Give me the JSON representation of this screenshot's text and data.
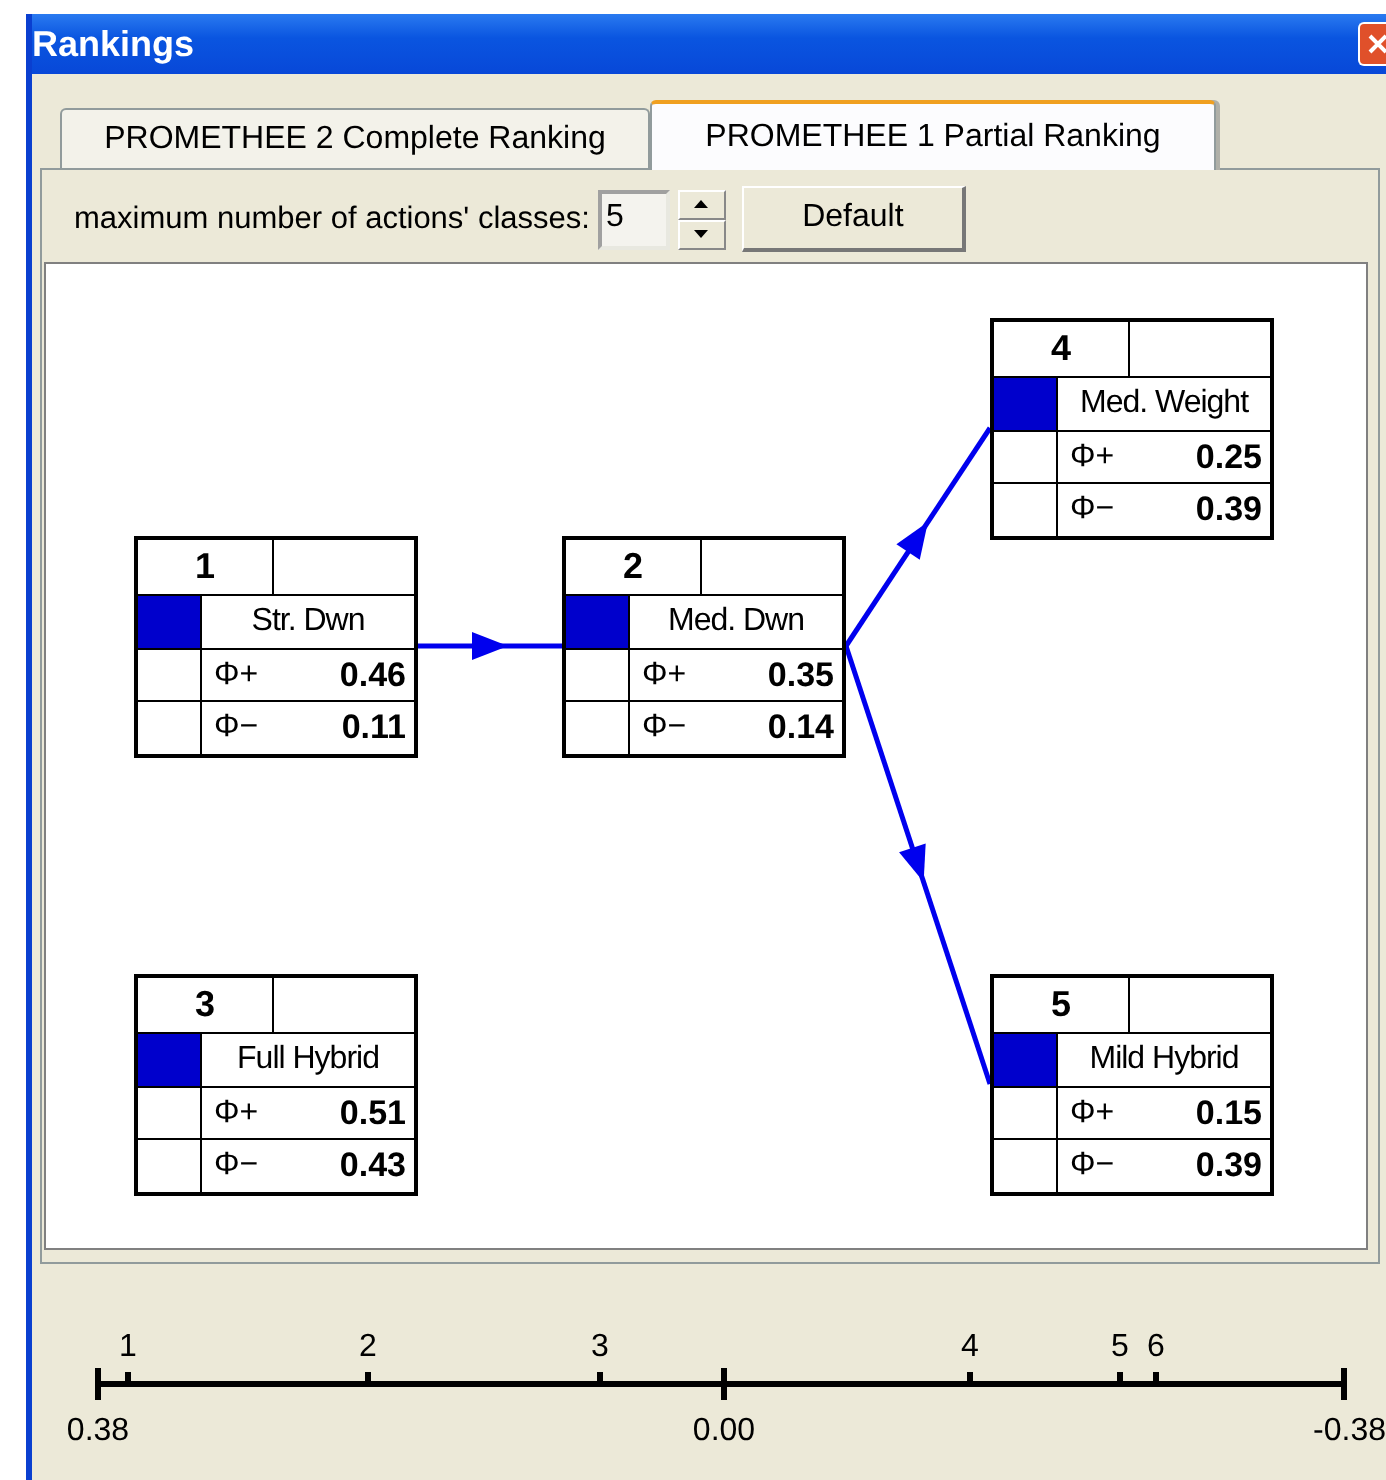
{
  "window": {
    "title": "Rankings"
  },
  "tabs": [
    {
      "label": "PROMETHEE 2 Complete Ranking",
      "selected": false
    },
    {
      "label": "PROMETHEE 1 Partial Ranking",
      "selected": true
    }
  ],
  "classes_control": {
    "label": "maximum number of actions' classes:",
    "value": "5"
  },
  "buttons": [
    "Default"
  ],
  "nodes": [
    {
      "number": "1",
      "name": "Str. Dwn",
      "phi_plus_label": "Φ+",
      "phi_plus": "0.46",
      "phi_minus_label": "Φ−",
      "phi_minus": "0.11"
    },
    {
      "number": "2",
      "name": "Med. Dwn",
      "phi_plus_label": "Φ+",
      "phi_plus": "0.35",
      "phi_minus_label": "Φ−",
      "phi_minus": "0.14"
    },
    {
      "number": "4",
      "name": "Med. Weight",
      "phi_plus_label": "Φ+",
      "phi_plus": "0.25",
      "phi_minus_label": "Φ−",
      "phi_minus": "0.39"
    },
    {
      "number": "3",
      "name": "Full Hybrid",
      "phi_plus_label": "Φ+",
      "phi_plus": "0.51",
      "phi_minus_label": "Φ−",
      "phi_minus": "0.43"
    },
    {
      "number": "5",
      "name": "Mild Hybrid",
      "phi_plus_label": "Φ+",
      "phi_plus": "0.15",
      "phi_minus_label": "Φ−",
      "phi_minus": "0.39"
    }
  ],
  "scale": {
    "action_labels": [
      "1",
      "2",
      "3",
      "4",
      "5",
      "6"
    ],
    "axis_labels": [
      "0.38",
      "0.00",
      "-0.38"
    ]
  }
}
